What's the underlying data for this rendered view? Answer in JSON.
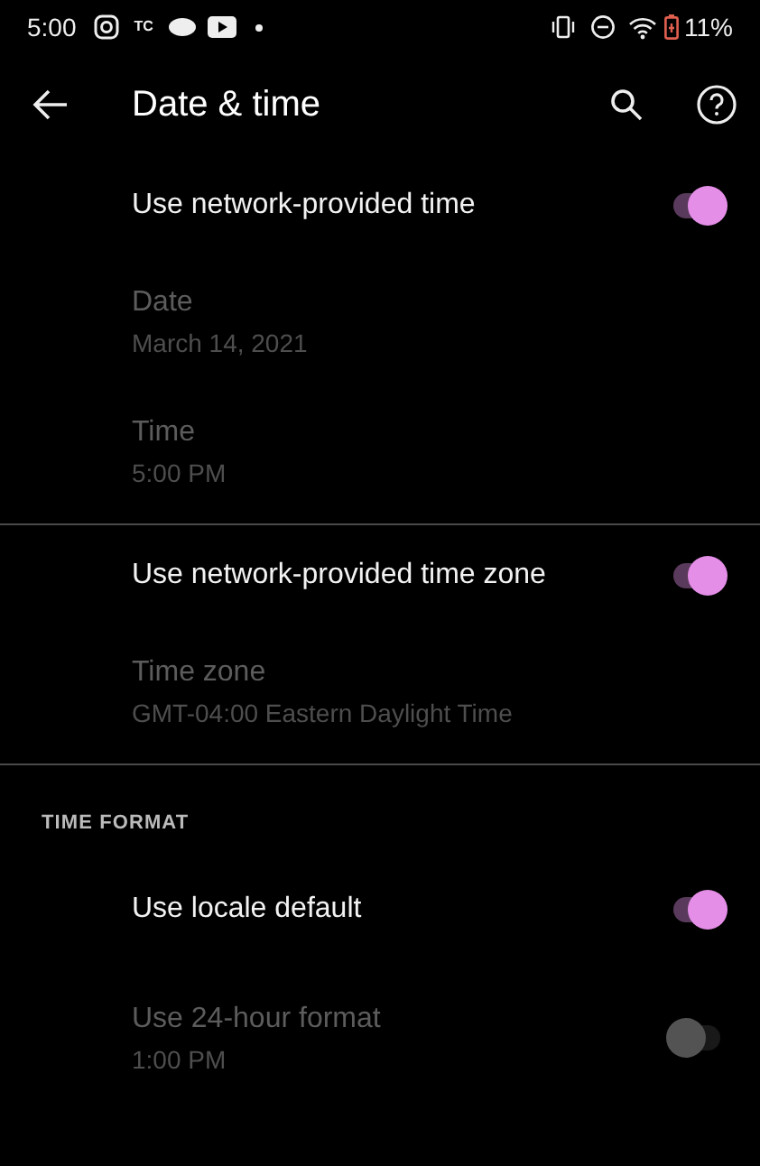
{
  "status_bar": {
    "time": "5:00",
    "notification_text": "TC",
    "battery": "11%"
  },
  "app_bar": {
    "title": "Date & time"
  },
  "groups": [
    {
      "items": [
        {
          "kind": "switch",
          "title": "Use network-provided time",
          "on": true,
          "disabled": false
        },
        {
          "kind": "plain",
          "title": "Date",
          "summary": "March 14, 2021",
          "disabled": true
        },
        {
          "kind": "plain",
          "title": "Time",
          "summary": "5:00 PM",
          "disabled": true
        }
      ]
    },
    {
      "items": [
        {
          "kind": "switch",
          "title": "Use network-provided time zone",
          "on": true,
          "disabled": false
        },
        {
          "kind": "plain",
          "title": "Time zone",
          "summary": "GMT-04:00 Eastern Daylight Time",
          "disabled": true
        }
      ]
    },
    {
      "header": "TIME FORMAT",
      "items": [
        {
          "kind": "switch",
          "title": "Use locale default",
          "on": true,
          "disabled": false
        },
        {
          "kind": "switch",
          "title": "Use 24-hour format",
          "summary": "1:00 PM",
          "on": false,
          "disabled": true
        }
      ]
    }
  ]
}
